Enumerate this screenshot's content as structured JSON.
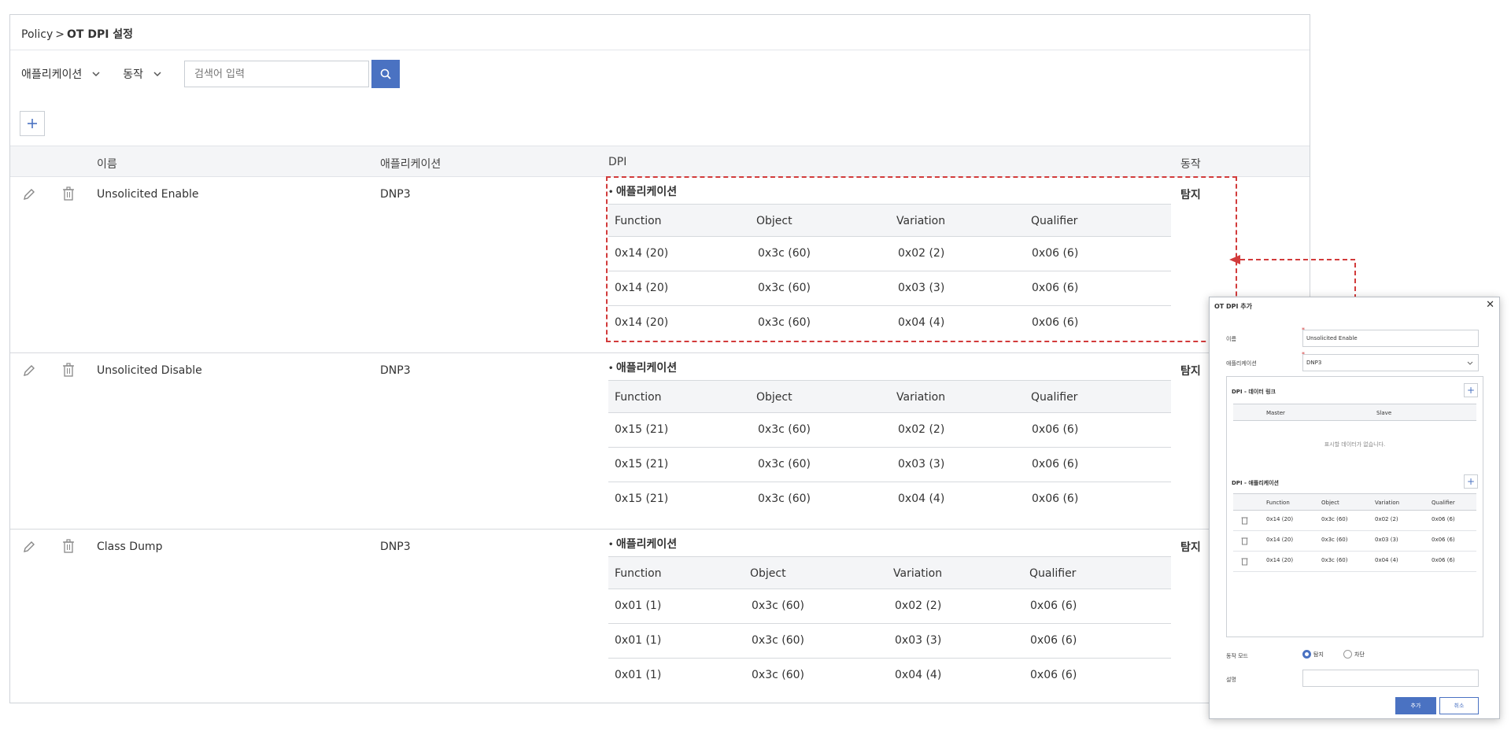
{
  "breadcrumb": {
    "root": "Policy",
    "separator": ">",
    "current": "OT DPI 설정"
  },
  "filters": {
    "application_label": "애플리케이션",
    "action_label": "동작",
    "search_placeholder": "검색어 입력"
  },
  "table": {
    "headers": {
      "name": "이름",
      "application": "애플리케이션",
      "dpi": "DPI",
      "action": "동작"
    },
    "rows": [
      {
        "name": "Unsolicited Enable",
        "application": "DNP3",
        "action": "탐지",
        "dpi_title": "애플리케이션",
        "dpi_headers": [
          "Function",
          "Object",
          "Variation",
          "Qualifier"
        ],
        "dpi_rows": [
          [
            "0x14 (20)",
            "0x3c (60)",
            "0x02 (2)",
            "0x06 (6)"
          ],
          [
            "0x14 (20)",
            "0x3c (60)",
            "0x03 (3)",
            "0x06 (6)"
          ],
          [
            "0x14 (20)",
            "0x3c (60)",
            "0x04 (4)",
            "0x06 (6)"
          ]
        ]
      },
      {
        "name": "Unsolicited Disable",
        "application": "DNP3",
        "action": "탐지",
        "dpi_title": "애플리케이션",
        "dpi_headers": [
          "Function",
          "Object",
          "Variation",
          "Qualifier"
        ],
        "dpi_rows": [
          [
            "0x15 (21)",
            "0x3c (60)",
            "0x02 (2)",
            "0x06 (6)"
          ],
          [
            "0x15 (21)",
            "0x3c (60)",
            "0x03 (3)",
            "0x06 (6)"
          ],
          [
            "0x15 (21)",
            "0x3c (60)",
            "0x04 (4)",
            "0x06 (6)"
          ]
        ]
      },
      {
        "name": "Class Dump",
        "application": "DNP3",
        "action": "탐지",
        "dpi_title": "애플리케이션",
        "dpi_headers": [
          "Function",
          "Object",
          "Variation",
          "Qualifier"
        ],
        "dpi_rows": [
          [
            "0x01 (1)",
            "0x3c (60)",
            "0x02 (2)",
            "0x06 (6)"
          ],
          [
            "0x01 (1)",
            "0x3c (60)",
            "0x03 (3)",
            "0x06 (6)"
          ],
          [
            "0x01 (1)",
            "0x3c (60)",
            "0x04 (4)",
            "0x06 (6)"
          ]
        ]
      }
    ]
  },
  "dialog": {
    "title": "OT DPI 추가",
    "close": "✕",
    "name_label": "이름",
    "name_value": "Unsolicited Enable",
    "app_label": "애플리케이션",
    "app_value": "DNP3",
    "link_section_title": "DPI - 데이터 링크",
    "link_headers": [
      "Master",
      "Slave"
    ],
    "link_empty": "표시할 데이터가 없습니다.",
    "app_section_title": "DPI - 애플리케이션",
    "app_headers": [
      "Function",
      "Object",
      "Variation",
      "Qualifier"
    ],
    "app_rows": [
      [
        "0x14 (20)",
        "0x3c (60)",
        "0x02 (2)",
        "0x06 (6)"
      ],
      [
        "0x14 (20)",
        "0x3c (60)",
        "0x03 (3)",
        "0x06 (6)"
      ],
      [
        "0x14 (20)",
        "0x3c (60)",
        "0x04 (4)",
        "0x06 (6)"
      ]
    ],
    "mode_label": "동작 모드",
    "mode_options": [
      "탐지",
      "차단"
    ],
    "mode_selected": "탐지",
    "desc_label": "설명",
    "submit_label": "추가",
    "cancel_label": "취소"
  },
  "colors": {
    "accent": "#4a72c2",
    "highlight": "#d23b3b",
    "header_bg": "#f4f5f7",
    "border": "#d6d9dd"
  },
  "icons": [
    "chevron-down-icon",
    "search-icon",
    "plus-icon",
    "pencil-icon",
    "trash-icon",
    "close-icon",
    "arrow-left-icon"
  ]
}
